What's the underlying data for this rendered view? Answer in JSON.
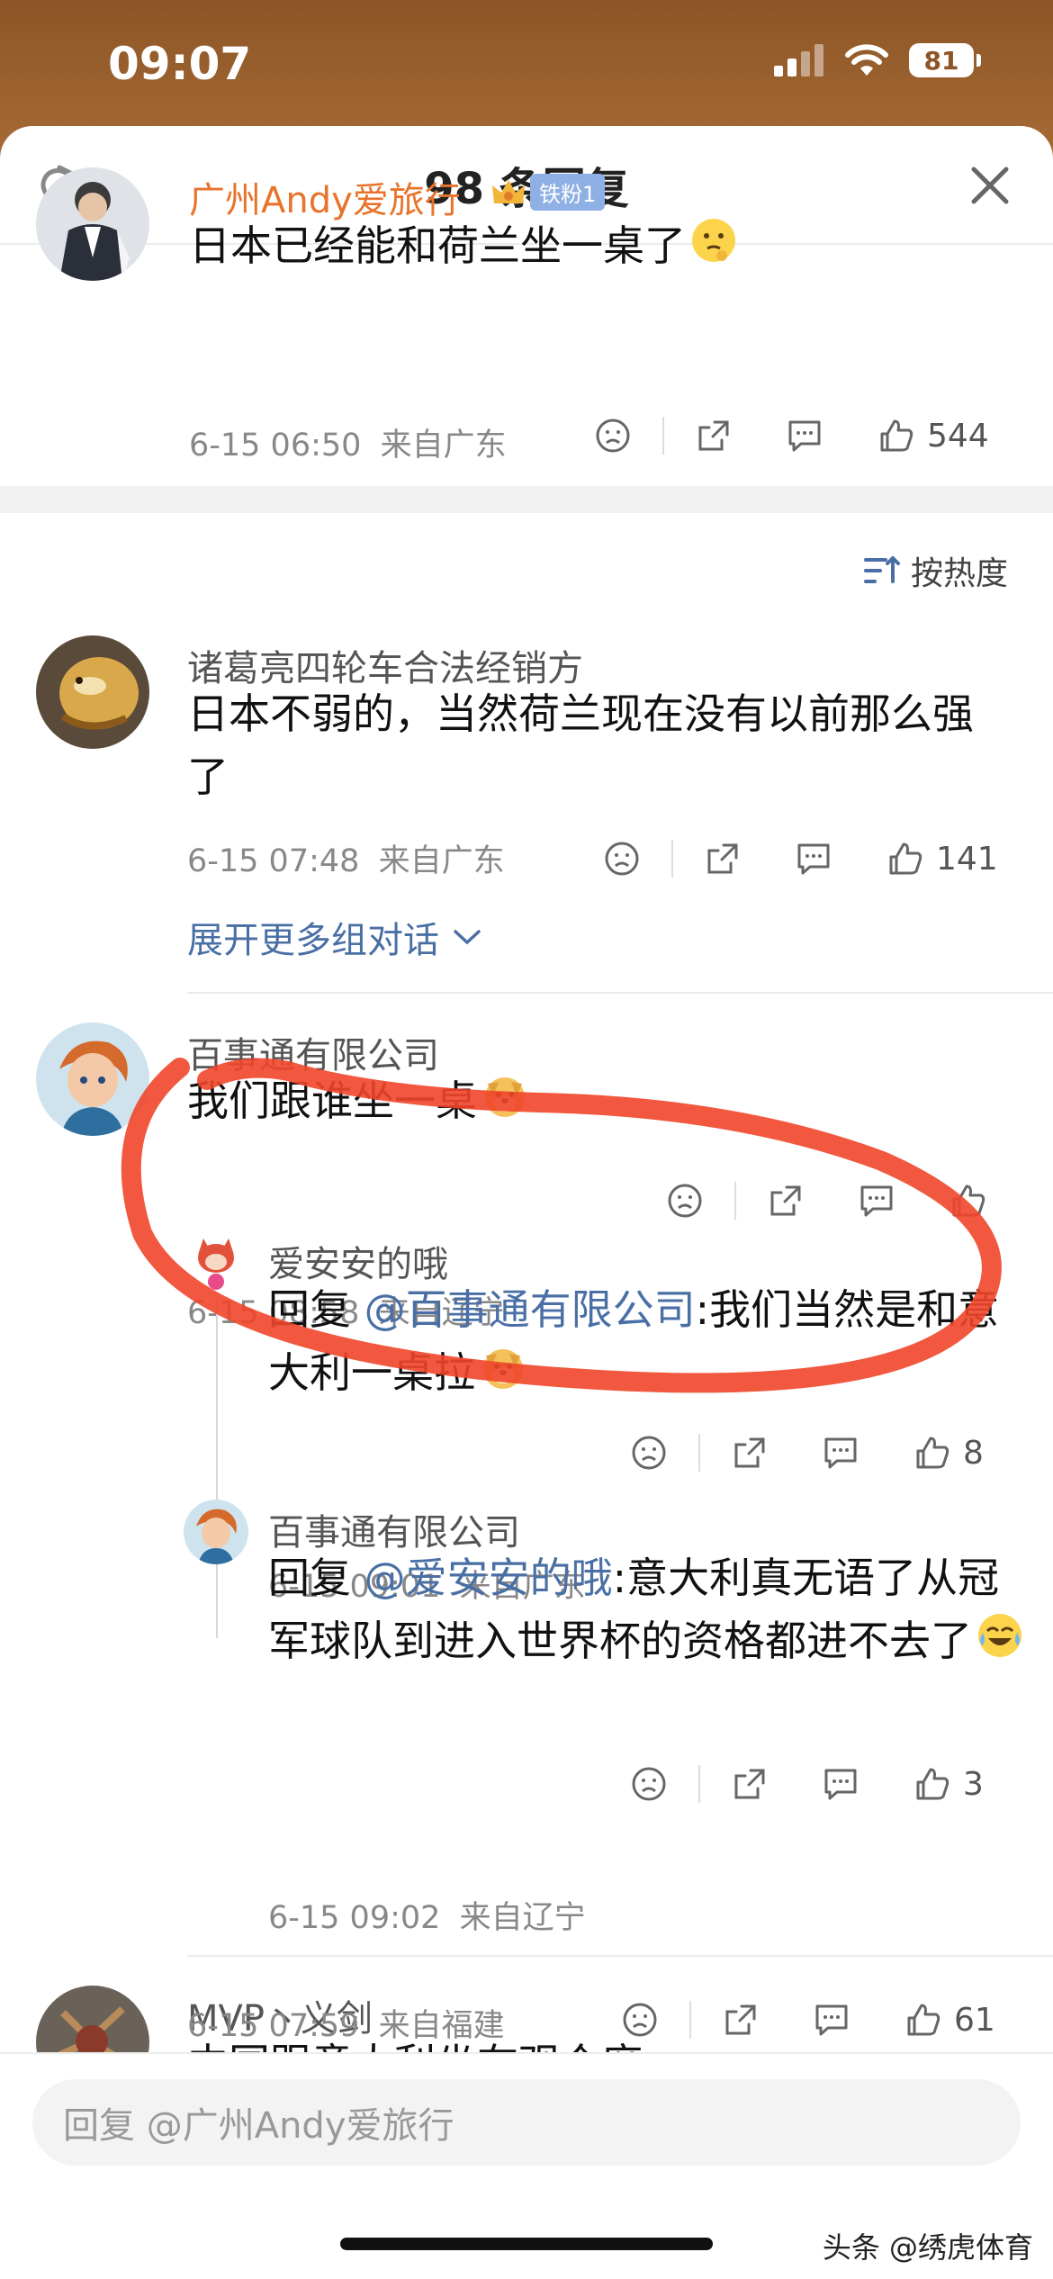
{
  "status": {
    "time": "09:07",
    "battery": "81"
  },
  "header": {
    "title": "98 条回复"
  },
  "top_comment": {
    "user": "广州Andy爱旅行",
    "badge": "铁粉1",
    "text": "日本已经能和荷兰坐一桌了",
    "time": "6-15 06:50",
    "location": "来自广东",
    "likes": "544"
  },
  "sort": {
    "label": "按热度"
  },
  "replies": [
    {
      "user": "诸葛亮四轮车合法经销方",
      "text": "日本不弱的，当然荷兰现在没有以前那么强了",
      "time": "6-15 07:48",
      "location": "来自广东",
      "likes": "141",
      "expand": "展开更多组对话"
    },
    {
      "user": "百事通有限公司",
      "text": "我们跟谁坐一桌",
      "time": "6-15 08:58",
      "location": "来自辽宁",
      "likes": "",
      "sub": [
        {
          "user": "爱安安的哦",
          "prefix": "回复 ",
          "mention": "@百事通有限公司",
          "text": ":我们当然是和意大利一桌拉",
          "time": "6-15 09:01",
          "location": "来自广东",
          "likes": "8"
        },
        {
          "user": "百事通有限公司",
          "prefix": "回复 ",
          "mention": "@爱安安的哦",
          "text": ":意大利真无语了从冠军球队到进入世界杯的资格都进不去了",
          "time": "6-15 09:02",
          "location": "来自辽宁",
          "likes": "3"
        }
      ]
    },
    {
      "user": "MVP丶义剑",
      "text": "中国跟意大利坐在观众席",
      "time": "6-15 07:59",
      "location": "来自福建",
      "likes": "61"
    }
  ],
  "reply_box": {
    "placeholder": "回复 @广州Andy爱旅行"
  },
  "watermark": "头条 @绣虎体育",
  "colors": {
    "accent_link": "#4a6fa5",
    "username_highlight": "#e8742c",
    "annotation": "#f0462a"
  }
}
